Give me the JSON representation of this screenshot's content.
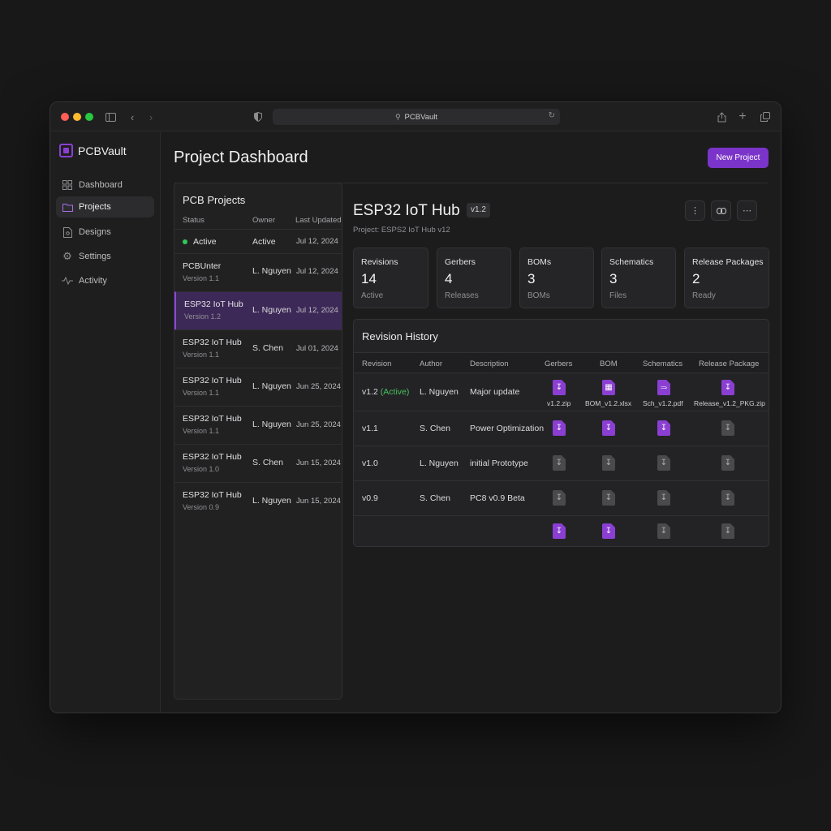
{
  "browser": {
    "url": "PCBVault"
  },
  "app": {
    "name": "PCBVault"
  },
  "sidebar": {
    "items": [
      {
        "label": "Dashboard",
        "icon": "grid-icon"
      },
      {
        "label": "Projects",
        "icon": "folder-icon"
      },
      {
        "label": "Designs",
        "icon": "file-icon"
      },
      {
        "label": "Settings",
        "icon": "gear-icon"
      },
      {
        "label": "Activity",
        "icon": "activity-icon"
      }
    ]
  },
  "header": {
    "title": "Project Dashboard",
    "new_project_label": "New Project"
  },
  "projects": {
    "title": "PCB Projects",
    "columns": [
      "Status",
      "Owner",
      "Last Updated"
    ],
    "rows": [
      {
        "name": "Active",
        "version": "",
        "owner": "Active",
        "updated": "Jul 12, 2024"
      },
      {
        "name": "PCBUnter",
        "version": "Version 1.1",
        "owner": "L. Nguyen",
        "updated": "Jul 12, 2024"
      },
      {
        "name": "ESP32 IoT Hub",
        "version": "Version 1.2",
        "owner": "L. Nguyen",
        "updated": "Jul 12, 2024"
      },
      {
        "name": "ESP32 IoT Hub",
        "version": "Version 1.1",
        "owner": "S. Chen",
        "updated": "Jul 01, 2024"
      },
      {
        "name": "ESP32 IoT Hub",
        "version": "Version 1.1",
        "owner": "L. Nguyen",
        "updated": "Jun 25, 2024"
      },
      {
        "name": "ESP32 IoT Hub",
        "version": "Version 1.1",
        "owner": "L. Nguyen",
        "updated": "Jun 25, 2024"
      },
      {
        "name": "ESP32 IoT Hub",
        "version": "Version 1.0",
        "owner": "S. Chen",
        "updated": "Jun 15, 2024"
      },
      {
        "name": "ESP32 IoT Hub",
        "version": "Version 0.9",
        "owner": "L. Nguyen",
        "updated": "Jun 15, 2024"
      }
    ]
  },
  "detail": {
    "title": "ESP32 IoT Hub",
    "version_tag": "v1.2",
    "subtitle": "Project: ESPS2 IoT Hub v12",
    "stats": [
      {
        "label": "Revisions",
        "value": "14",
        "sub": "Active"
      },
      {
        "label": "Gerbers",
        "value": "4",
        "sub": "Releases"
      },
      {
        "label": "BOMs",
        "value": "3",
        "sub": "BOMs"
      },
      {
        "label": "Schematics",
        "value": "3",
        "sub": "Files"
      },
      {
        "label": "Release Packages",
        "value": "2",
        "sub": "Ready"
      }
    ]
  },
  "revision_history": {
    "title": "Revision History",
    "columns": [
      "Revision",
      "Author",
      "Description",
      "Gerbers",
      "BOM",
      "Schematics",
      "Release Package"
    ],
    "rows": [
      {
        "revision": "v1.2",
        "active_label": "(Active)",
        "author": "L. Nguyen",
        "description": "Major update",
        "files": [
          "v1.2.zip",
          "BOM_v1.2.xlsx",
          "Sch_v1.2.pdf",
          "Release_v1.2_PKG.zip"
        ]
      },
      {
        "revision": "v1.1",
        "active_label": "",
        "author": "S. Chen",
        "description": "Power Optimization"
      },
      {
        "revision": "v1.0",
        "active_label": "",
        "author": "L. Nguyen",
        "description": "initial Prototype"
      },
      {
        "revision": "v0.9",
        "active_label": "",
        "author": "S. Chen",
        "description": "PC8 v0.9 Beta"
      }
    ]
  },
  "colors": {
    "accent": "#7b34c9",
    "active_green": "#49c25e",
    "background": "#181818"
  }
}
